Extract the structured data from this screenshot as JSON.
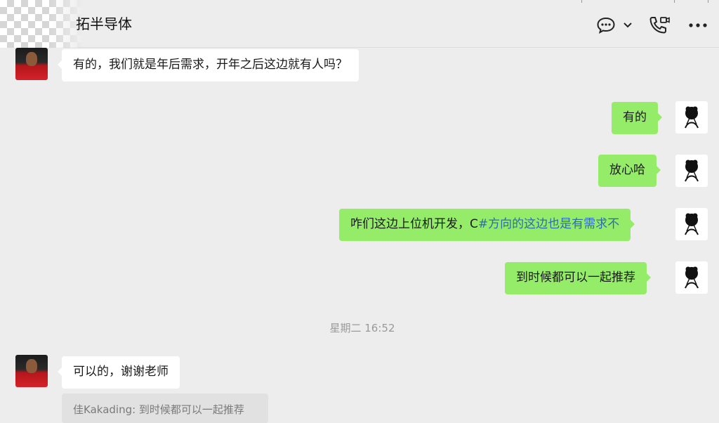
{
  "header": {
    "title": "拓半导体",
    "icons": [
      "chat-bubble-icon",
      "chevron-down-icon",
      "phone-video-icon",
      "more-icon"
    ]
  },
  "messages": [
    {
      "side": "left",
      "text": "有的，我们就是年后需求，开年之后这边就有人吗？",
      "avatar": "red-jersey-avatar"
    },
    {
      "side": "right",
      "text": "有的",
      "avatar": "sketch-avatar"
    },
    {
      "side": "right",
      "text": "放心哈",
      "avatar": "sketch-avatar"
    },
    {
      "side": "right",
      "text_before": "咋们这边上位机开发，C",
      "text_link": "#方向的这边也是有需求不",
      "avatar": "sketch-avatar"
    },
    {
      "side": "right",
      "text": "到时候都可以一起推荐",
      "avatar": "sketch-avatar"
    },
    {
      "side": "left",
      "text": "可以的，谢谢老师",
      "avatar": "red-jersey-avatar"
    }
  ],
  "timestamp": "星期二 16:52",
  "quote": "佳Kakading: 到时候都可以一起推荐",
  "colors": {
    "background": "#ededed",
    "bubble_self": "#95ec69",
    "bubble_other": "#ffffff",
    "link": "#2b6bb3"
  }
}
